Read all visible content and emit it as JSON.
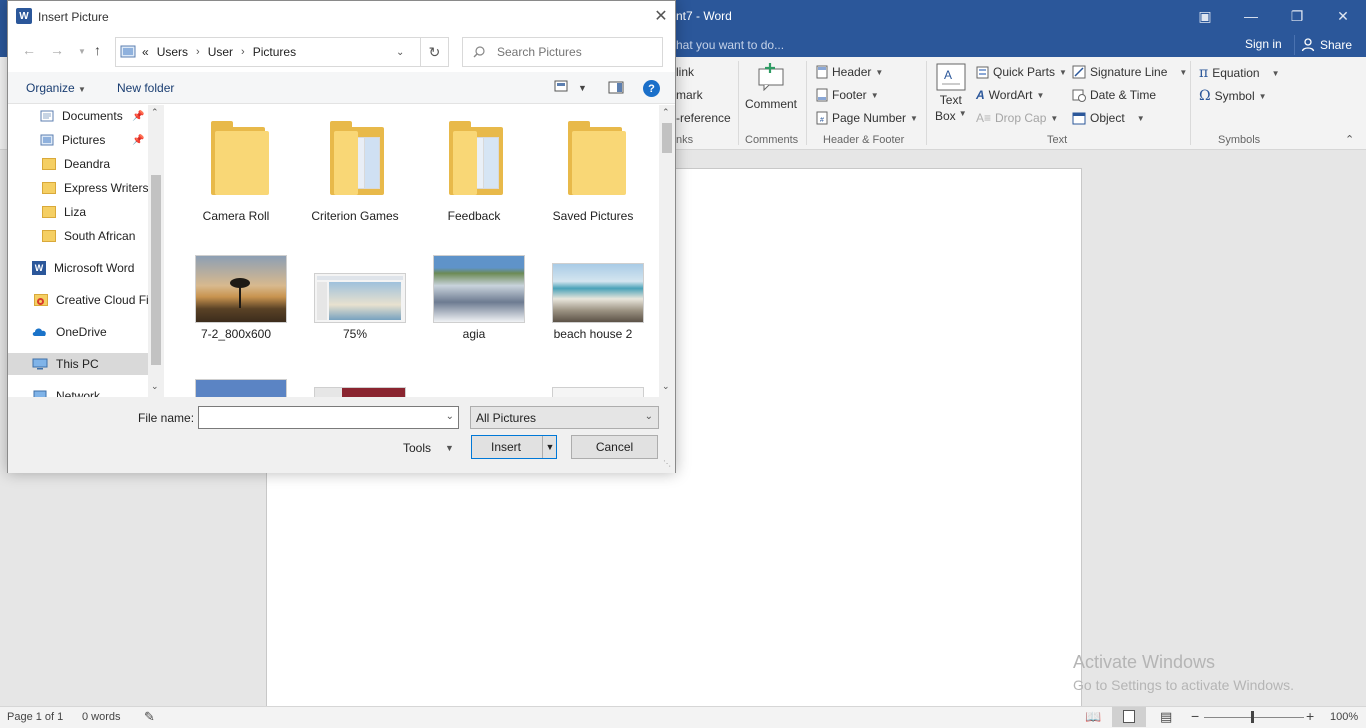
{
  "word": {
    "title": "nt7 - Word",
    "tell_me": "hat you want to do...",
    "sign_in": "Sign in",
    "share": "Share",
    "ribbon": {
      "links": [
        "link",
        "mark",
        "-reference"
      ],
      "links_group": "nks",
      "comment": "Comment",
      "comments_group": "Comments",
      "header": "Header",
      "footer": "Footer",
      "page_number": "Page Number",
      "header_footer_group": "Header & Footer",
      "text_box_1": "Text",
      "text_box_2": "Box",
      "quick_parts": "Quick Parts",
      "wordart": "WordArt",
      "drop_cap": "Drop Cap",
      "signature_line": "Signature Line",
      "date_time": "Date & Time",
      "object": "Object",
      "text_group": "Text",
      "equation": "Equation",
      "symbol": "Symbol",
      "symbols_group": "Symbols"
    },
    "watermark": {
      "line1": "Activate Windows",
      "line2": "Go to Settings to activate Windows."
    },
    "status": {
      "page": "Page 1 of 1",
      "words": "0 words",
      "zoom": "100%"
    }
  },
  "dialog": {
    "title": "Insert Picture",
    "address": {
      "prefix": "«",
      "segments": [
        "Users",
        "User",
        "Pictures"
      ]
    },
    "search_placeholder": "Search Pictures",
    "organize": "Organize",
    "new_folder": "New folder",
    "nav_items": [
      {
        "label": "Documents",
        "icon": "documents-icon",
        "pinned": true
      },
      {
        "label": "Pictures",
        "icon": "pictures-icon",
        "pinned": true
      },
      {
        "label": "Deandra",
        "icon": "folder-icon"
      },
      {
        "label": "Express Writers",
        "icon": "folder-icon"
      },
      {
        "label": "Liza",
        "icon": "folder-icon"
      },
      {
        "label": "South African",
        "icon": "folder-icon"
      },
      {
        "label": "Microsoft Word",
        "icon": "word-icon"
      },
      {
        "label": "Creative Cloud Fil",
        "icon": "creative-cloud-icon"
      },
      {
        "label": "OneDrive",
        "icon": "onedrive-icon"
      },
      {
        "label": "This PC",
        "icon": "this-pc-icon",
        "selected": true
      },
      {
        "label": "Network",
        "icon": "network-icon"
      }
    ],
    "folders": [
      "Camera Roll",
      "Criterion Games",
      "Feedback",
      "Saved Pictures"
    ],
    "images": [
      "7-2_800x600",
      "75%",
      "agia",
      "beach house 2"
    ],
    "file_name_label": "File name:",
    "file_name_value": "",
    "filter": "All Pictures",
    "tools": "Tools",
    "insert": "Insert",
    "cancel": "Cancel"
  }
}
